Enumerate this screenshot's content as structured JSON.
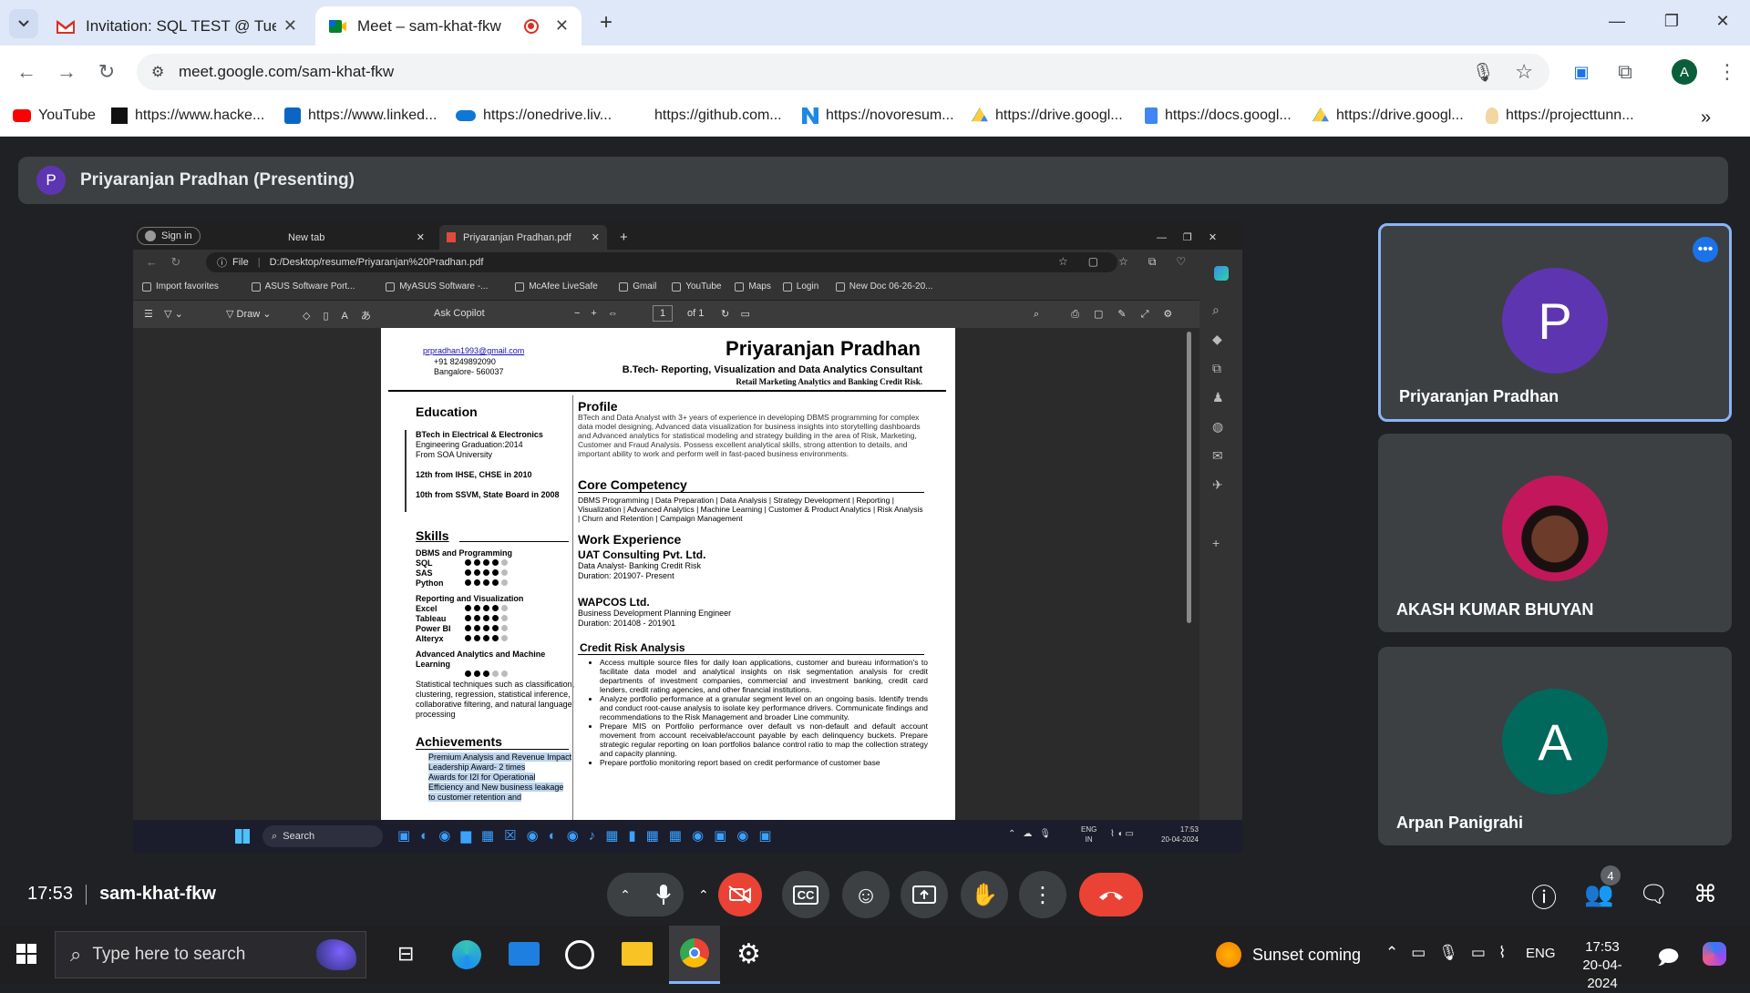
{
  "browser": {
    "tabs": [
      {
        "title": "Invitation: SQL TEST @ Tue Ap",
        "icon": "gmail-icon"
      },
      {
        "title": "Meet – sam-khat-fkw",
        "icon": "meet-icon",
        "recording": true
      }
    ],
    "url": "meet.google.com/sam-khat-fkw",
    "profile_initial": "A",
    "bookmarks": [
      "YouTube",
      "https://www.hacke...",
      "https://www.linked...",
      "https://onedrive.liv...",
      "https://github.com...",
      "https://novoresum...",
      "https://drive.googl...",
      "https://docs.googl...",
      "https://drive.googl...",
      "https://projecttunn..."
    ]
  },
  "meet": {
    "presenter_initial": "P",
    "presenter_label": "Priyaranjan Pradhan (Presenting)",
    "time": "17:53",
    "meeting_code": "sam-khat-fkw",
    "participant_count": "4",
    "participants": [
      {
        "name": "Priyaranjan Pradhan",
        "initial": "P",
        "color": "#5e35b1"
      },
      {
        "name": "AKASH KUMAR BHUYAN",
        "initial": "",
        "color": "#d81b60"
      },
      {
        "name": "Arpan Panigrahi",
        "initial": "A",
        "color": "#00695c"
      }
    ]
  },
  "shared": {
    "edge_tabs": [
      "Sign in",
      "New tab",
      "Priyaranjan Pradhan.pdf"
    ],
    "file_label": "File",
    "address": "D:/Desktop/resume/Priyaranjan%20Pradhan.pdf",
    "bookmarks": [
      "Import favorites",
      "ASUS Software Port...",
      "MyASUS Software -...",
      "McAfee LiveSafe",
      "Gmail",
      "YouTube",
      "Maps",
      "Login",
      "New Doc 06-26-20..."
    ],
    "pdf_toolbar": {
      "draw": "Draw",
      "copilot": "Ask Copilot",
      "page": "1",
      "of": "of 1"
    },
    "taskbar": {
      "search": "Search",
      "lang": "ENG",
      "region": "IN",
      "time": "17:53",
      "date": "20-04-2024"
    },
    "resume": {
      "name": "Priyaranjan Pradhan",
      "subtitle": "B.Tech- Reporting, Visualization and Data Analytics Consultant",
      "subtitle2": "Retail Marketing Analytics and Banking Credit Risk.",
      "email": "prpradhan1993@gmail.com",
      "phone": "+91 8249892090",
      "location": "Bangalore- 560037",
      "education_title": "Education",
      "education": [
        "BTech in Electrical & Electronics",
        "Engineering Graduation:2014",
        "From SOA University",
        "12th from IHSE, CHSE in 2010",
        "10th from SSVM, State Board in 2008"
      ],
      "skills_title": "Skills",
      "skill_groups": [
        {
          "title": "DBMS and Programming",
          "items": [
            {
              "n": "SQL",
              "v": 4.5
            },
            {
              "n": "SAS",
              "v": 4
            },
            {
              "n": "Python",
              "v": 4
            }
          ]
        },
        {
          "title": "Reporting and Visualization",
          "items": [
            {
              "n": "Excel",
              "v": 4.5
            },
            {
              "n": "Tableau",
              "v": 4
            },
            {
              "n": "Power BI",
              "v": 4
            },
            {
              "n": "Alteryx",
              "v": 4
            }
          ]
        },
        {
          "title": "Advanced Analytics and Machine Learning",
          "items": [
            {
              "n": "",
              "v": 3
            }
          ]
        }
      ],
      "ml_desc": "Statistical techniques such as classification, clustering, regression, statistical inference, collaborative filtering, and natural language processing",
      "achievements_title": "Achievements",
      "achievements": [
        "Premium Analysis and Revenue Impact Leadership Award- 2 times",
        "Awards for I2I for Operational Efficiency and New business leakage to customer retention and"
      ],
      "profile_title": "Profile",
      "profile": "BTech and Data Analyst with 3+ years of experience in developing DBMS programming for complex data model designing, Advanced data visualization for business insights into storytelling dashboards and Advanced analytics for statistical modeling and strategy building in the area of Risk, Marketing, Customer and Fraud Analysis. Possess excellent analytical skills, strong attention to details, and important ability to work and perform well in fast-paced business environments.",
      "core_title": "Core Competency",
      "core": "DBMS Programming | Data Preparation | Data Analysis | Strategy Development | Reporting | Visualization | Advanced Analytics | Machine Learning | Customer & Product Analytics | Risk Analysis | Churn and Retention | Campaign Management",
      "work_title": "Work Experience",
      "jobs": [
        {
          "company": "UAT Consulting  Pvt. Ltd.",
          "role": "Data Analyst- Banking Credit Risk",
          "duration": "Duration: 201907- Present"
        },
        {
          "company": "WAPCOS Ltd.",
          "role": "Business Development Planning Engineer",
          "duration": "Duration: 201408 - 201901"
        }
      ],
      "credit_title": "Credit Risk Analysis",
      "credit_points": [
        "Access multiple source files for daily loan applications, customer and bureau information's to facilitate data model and analytical insights on risk segmentation analysis for credit departments of investment companies, commercial and investment banking, credit card lenders, credit rating agencies, and other financial institutions.",
        "Analyze portfolio performance at a granular segment level on an ongoing basis. Identify trends and conduct root-cause analysis to isolate key performance drivers. Communicate findings and recommendations to the Risk Management and broader Line community.",
        "Prepare MIS on Portfolio performance over default vs non-default and default account movement from account receivable/account payable by each delinquency buckets. Prepare strategic regular reporting on loan portfolios balance control ratio to map the collection strategy and capacity planning.",
        "Prepare portfolio monitoring report based on credit performance of customer base"
      ]
    }
  },
  "taskbar": {
    "search_placeholder": "Type here to search",
    "weather": "Sunset coming",
    "lang": "ENG",
    "time": "17:53",
    "date": "20-04-2024"
  }
}
